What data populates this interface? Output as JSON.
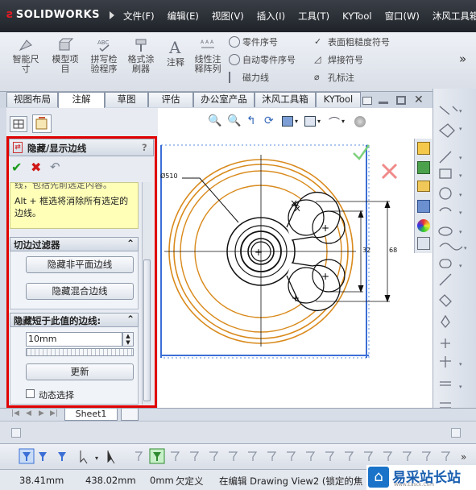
{
  "app": {
    "logo": "SOLIDWORKS"
  },
  "menu": [
    "文件(F)",
    "编辑(E)",
    "视图(V)",
    "插入(I)",
    "工具(T)",
    "KYTool",
    "窗口(W)",
    "沐风工具箱"
  ],
  "command_manager": {
    "smart_dimension": "智能尺\n寸",
    "model_items": "模型项\n目",
    "spell_check": "拼写检\n验程序",
    "format_painter": "格式涂\n刷器",
    "note": "注释",
    "linear_pattern": "线性注\n释阵列",
    "balloon": "零件序号",
    "auto_balloon": "自动零件序号",
    "magnetic_line": "磁力线",
    "surface_finish": "表面粗糙度符号",
    "weld_symbol": "焊接符号",
    "hole_callout": "孔标注",
    "more": "»"
  },
  "tabs": [
    "视图布局",
    "注解",
    "草图",
    "评估",
    "办公室产品",
    "沐风工具箱",
    "KYTool"
  ],
  "active_tab": "注解",
  "property_manager": {
    "title": "隐藏/显示边线",
    "help": "?",
    "message_partial": "线，包括先前选定内容。",
    "message": "Alt + 框选将消除所有选定的边线。",
    "filter_group": "切边过滤器",
    "hide_nonplanar": "隐藏非平面边线",
    "hide_blend": "隐藏混合边线",
    "short_edges_group": "隐藏短于此值的边线:",
    "length_value": "10mm",
    "update": "更新",
    "dynamic_select": "动态选择"
  },
  "drawing": {
    "dim_diameter": "Ø510",
    "dim_32": "32",
    "dim_68": "68"
  },
  "sheet_tab": "Sheet1",
  "status": {
    "x": "38.41mm",
    "y": "438.02mm",
    "z": "0mm",
    "state": "欠定义",
    "editing": "在编辑 Drawing View2 (锁定的焦"
  },
  "watermark": {
    "text": "易采站长站",
    "sub": "Www.Easck.Com"
  },
  "colors": {
    "accent_red": "#e00000",
    "circle_orange": "#d98a1c",
    "selection_blue": "#3b6fd6"
  }
}
